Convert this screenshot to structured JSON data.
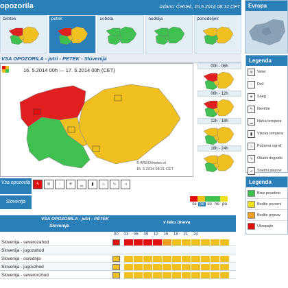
{
  "header": {
    "title": "opozorila",
    "issued": "izdano: Četrtek, 15.5.2014 08:12 CET"
  },
  "day_tabs": [
    {
      "label": "četrtek",
      "colors": [
        "#e02020",
        "#f0c020",
        "#f0c020",
        "#40c050"
      ]
    },
    {
      "label": "petek",
      "colors": [
        "#e02020",
        "#f0c020",
        "#f0c020",
        "#40c050"
      ],
      "selected": true
    },
    {
      "label": "sobota",
      "colors": [
        "#40c050",
        "#40c050",
        "#40c050",
        "#40c050"
      ]
    },
    {
      "label": "nedelja",
      "colors": [
        "#40c050",
        "#40c050",
        "#40c050",
        "#40c050"
      ]
    },
    {
      "label": "ponedeljek",
      "colors": [
        "#f0c020",
        "#f0c020",
        "#40c050",
        "#40c050"
      ]
    }
  ],
  "europe": {
    "title": "Evropa"
  },
  "breadcrumb": "VSA OPOZORILA - jutri - PETEK - Slovenija",
  "map": {
    "date_range": "16. 5.2014  00h  —  17. 5.2014  00h    (CET)",
    "watermark_1": "© ARSO/meteo.si",
    "watermark_2": "15. 5.2014  08:31 CET"
  },
  "hour_slots": [
    {
      "label": "00h - 06h"
    },
    {
      "label": "06h - 12h"
    },
    {
      "label": "12h - 18h"
    },
    {
      "label": "18h - 24h"
    }
  ],
  "legend_types": {
    "title": "Legenda",
    "items": [
      {
        "label": "Veter",
        "icon": "wind-icon",
        "glyph": "≋"
      },
      {
        "label": "Dež",
        "icon": "rain-icon",
        "glyph": "⁖"
      },
      {
        "label": "Sneg",
        "icon": "snow-icon",
        "glyph": "✳"
      },
      {
        "label": "Nevihte",
        "icon": "thunderstorm-icon",
        "glyph": "ϟ"
      },
      {
        "label": "Nizka tempera",
        "icon": "low-temperature-icon",
        "glyph": "▁"
      },
      {
        "label": "Visoka tempera",
        "icon": "high-temperature-icon",
        "glyph": "▮"
      },
      {
        "label": "Požarna ogrož",
        "icon": "fire-icon",
        "glyph": "♨"
      },
      {
        "label": "Obalni dogodki",
        "icon": "coastal-icon",
        "glyph": "∿"
      },
      {
        "label": "Snežni plazovi",
        "icon": "avalanche-icon",
        "glyph": "⩘"
      }
    ]
  },
  "legend_levels": {
    "title": "Legenda",
    "items": [
      {
        "label": "Brez posebno",
        "color": "#40c050"
      },
      {
        "label": "Bodite pozorni",
        "color": "#f0e020"
      },
      {
        "label": "Bodite priprav",
        "color": "#f0a020"
      },
      {
        "label": "Ukrepajte",
        "color": "#e01010"
      }
    ]
  },
  "side_labels": {
    "all_warnings": "Vsa opozorila",
    "slovenia": "Slovenija"
  },
  "filter_icons": [
    {
      "name": "thunderstorm-filter-icon",
      "glyph": "ϟ",
      "active": true
    },
    {
      "name": "wind-filter-icon",
      "glyph": "≋"
    },
    {
      "name": "rain-filter-icon",
      "glyph": "⁖"
    },
    {
      "name": "snow-filter-icon",
      "glyph": "✳"
    },
    {
      "name": "low-temp-filter-icon",
      "glyph": "▁"
    },
    {
      "name": "high-temp-filter-icon",
      "glyph": "▮"
    },
    {
      "name": "fire-filter-icon",
      "glyph": "♨"
    },
    {
      "name": "coastal-filter-icon",
      "glyph": "∿"
    },
    {
      "name": "avalanche-filter-icon",
      "glyph": "⩘"
    }
  ],
  "day_selector": {
    "colors": [
      "#e01010",
      "#f0c020",
      "#40c050",
      "#40c050",
      "#f0e020"
    ],
    "labels": [
      "če",
      "pe",
      "so",
      "ne",
      "po"
    ],
    "selected": 1
  },
  "table": {
    "title": "VSA OPOZORILA - jutri - PETEK",
    "region_header": "Slovenija",
    "time_header": "v teku dneva",
    "hours": [
      "00",
      "03",
      "06",
      "09",
      "12",
      "15",
      "18",
      "21",
      "24"
    ],
    "rows": [
      {
        "name": "Slovenija - severozahod",
        "icon_color": "#e01010",
        "cells": [
          "#e01010",
          "#e01010",
          "#e01010",
          "#e01010",
          "#f0a020",
          "#f0c020",
          "#f0c020",
          "#f0c020",
          "#f0c020",
          "#f0c020",
          "#f0c020"
        ]
      },
      {
        "name": "Slovenija - jugozahod",
        "icon_color": "",
        "cells": []
      },
      {
        "name": "Slovenija - osrednja",
        "icon_color": "#f0c020",
        "cells": [
          "#f0c020",
          "#f0c020",
          "#f0c020",
          "#f0c020",
          "#f0c020",
          "#f0c020",
          "#f0c020",
          "#f0c020",
          "#f0c020",
          "#f0c020",
          "#f0c020"
        ]
      },
      {
        "name": "Slovenija - jugovzhod",
        "icon_color": "#f0c020",
        "cells": [
          "#f0c020",
          "#f0c020",
          "#f0c020",
          "#f0c020",
          "#f0c020",
          "#f0c020",
          "#f0c020",
          "#f0c020",
          "#f0c020",
          "#f0c020",
          "#f0c020"
        ]
      },
      {
        "name": "Slovenija - severovzhod",
        "icon_color": "#f0c020",
        "cells": [
          "#f0c020",
          "#f0c020",
          "#f0c020",
          "#f0c020",
          "#f0c020",
          "#f0c020",
          "#f0c020",
          "#f0c020",
          "#f0c020",
          "#f0c020",
          "#f0c020"
        ]
      }
    ]
  }
}
